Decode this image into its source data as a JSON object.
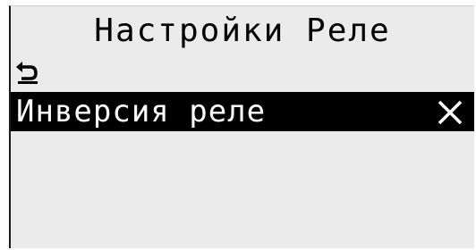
{
  "screen": {
    "title": "Настройки Реле",
    "back_icon": "back-arrow-icon",
    "items": [
      {
        "label": "Инверсия реле",
        "value_icon": "cross-icon",
        "selected": true
      }
    ]
  },
  "colors": {
    "background": "#ebebeb",
    "text": "#000000",
    "selection_background": "#000000",
    "selection_text": "#ffffff"
  }
}
